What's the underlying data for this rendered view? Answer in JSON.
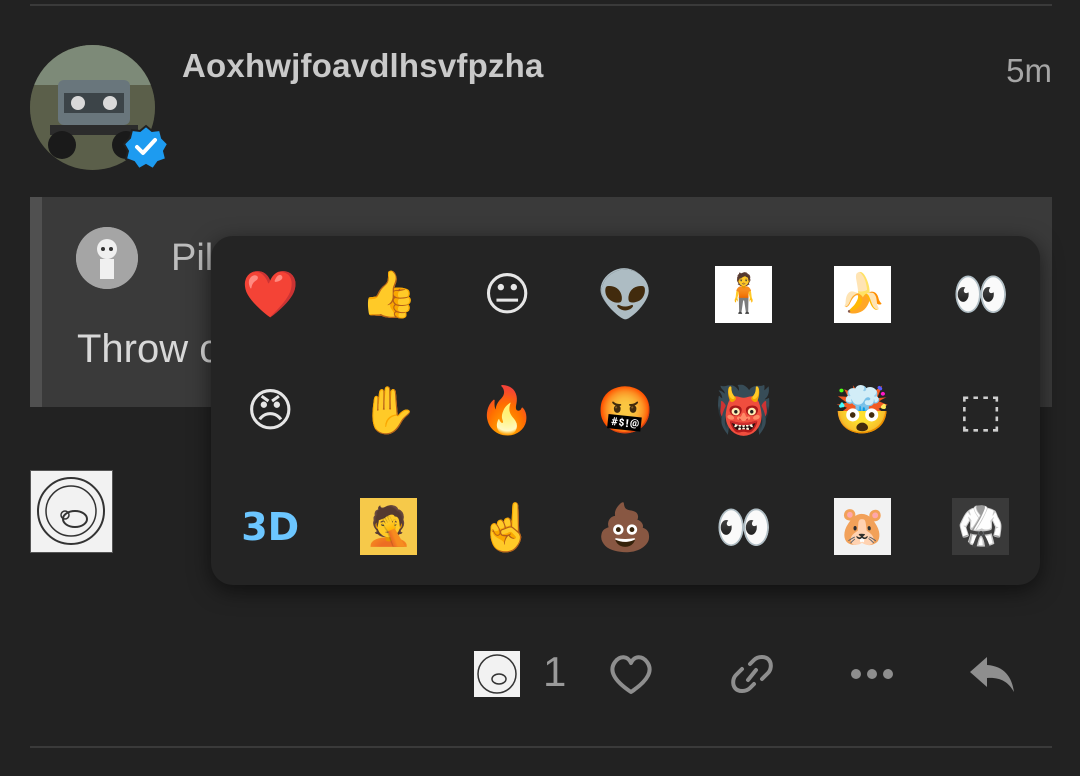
{
  "post": {
    "username": "Aoxhwjfoavdlhsvfpzha",
    "timestamp": "5m"
  },
  "quote": {
    "name_visible": "Pil",
    "text_visible": "Throw c"
  },
  "picker": {
    "reactions": [
      {
        "name": "heart",
        "glyph": "❤️"
      },
      {
        "name": "thumbs-up",
        "glyph": "👍"
      },
      {
        "name": "neutral-face",
        "glyph": "😐"
      },
      {
        "name": "alien-smile",
        "glyph": "👽"
      },
      {
        "name": "vault-boy",
        "glyph": "🧍"
      },
      {
        "name": "dancing-banana",
        "glyph": "🍌"
      },
      {
        "name": "eyes",
        "glyph": "👀"
      },
      {
        "name": "face-photo",
        "glyph": "😠"
      },
      {
        "name": "xray-hand",
        "glyph": "✋"
      },
      {
        "name": "dumpster-fire",
        "glyph": "🔥"
      },
      {
        "name": "cursing-face",
        "glyph": "🤬"
      },
      {
        "name": "red-creature",
        "glyph": "👹"
      },
      {
        "name": "exploding-head",
        "glyph": "🤯"
      },
      {
        "name": "bezier-tool",
        "glyph": "⬚"
      },
      {
        "name": "3d-print",
        "glyph": "3D"
      },
      {
        "name": "facepalm",
        "glyph": "🤦"
      },
      {
        "name": "pointing-up",
        "glyph": "☝️"
      },
      {
        "name": "poop",
        "glyph": "💩"
      },
      {
        "name": "googly-eyes",
        "glyph": "👀"
      },
      {
        "name": "hamster-wheel",
        "glyph": "🐹"
      },
      {
        "name": "street-fighter",
        "glyph": "🥋"
      }
    ]
  },
  "actions": {
    "reaction_count": "1"
  },
  "colors": {
    "background": "#222222",
    "quote_bg": "#3a3a3a",
    "picker_bg": "#242424",
    "verified_blue": "#1d9bf0",
    "icon_gray": "#8e8e8e"
  }
}
